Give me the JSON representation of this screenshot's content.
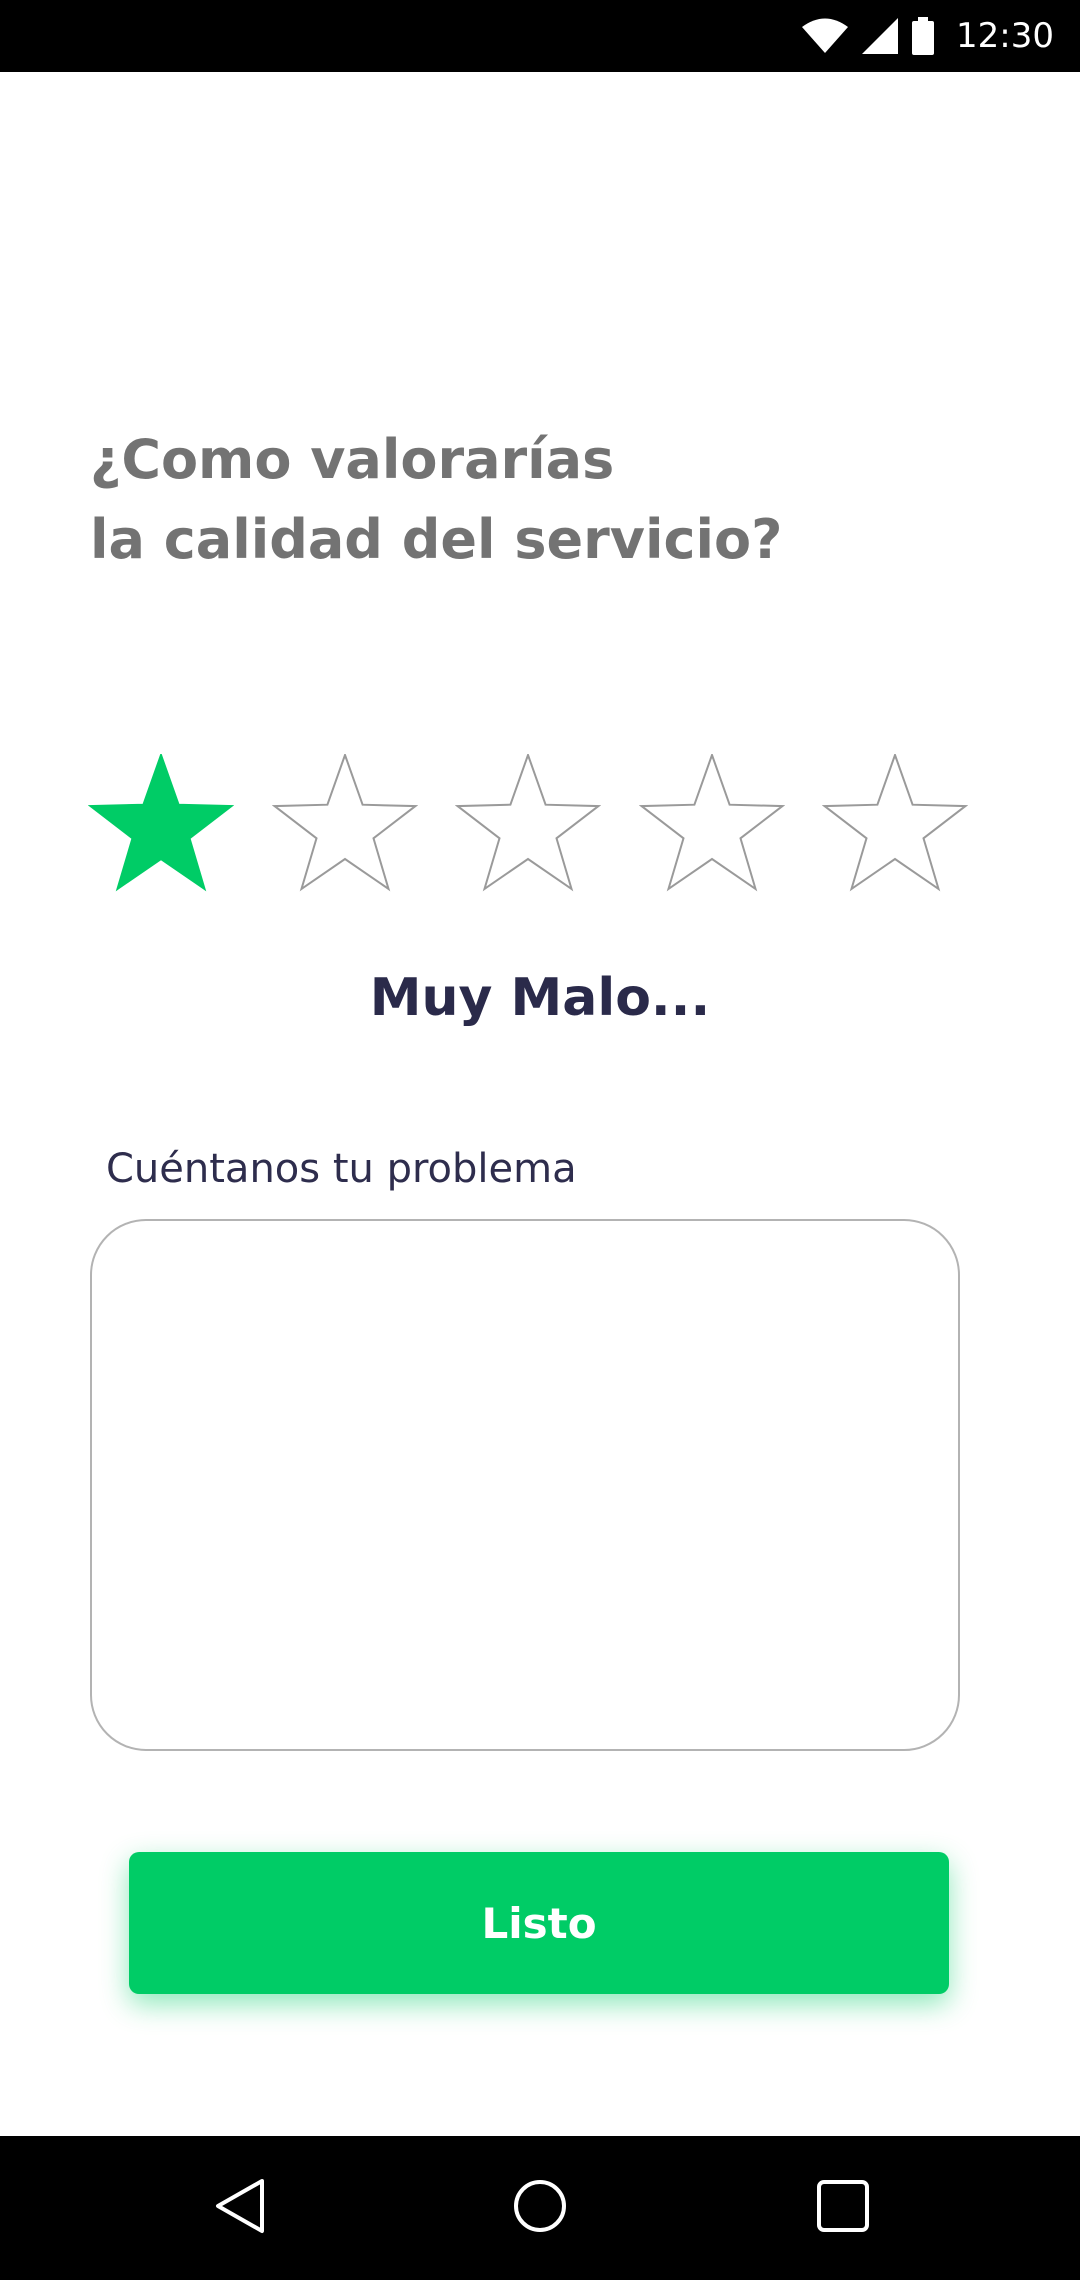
{
  "status_bar": {
    "time": "12:30",
    "icons": [
      "wifi-icon",
      "cellular-signal-icon",
      "battery-icon"
    ]
  },
  "question": {
    "line1": "¿Como valorarías",
    "line2": "la calidad del servicio?"
  },
  "rating": {
    "value": 1,
    "max": 5,
    "label": "Muy Malo...",
    "filled_color": "#00cc66",
    "empty_outline_color": "#9a9a9a"
  },
  "problem_field": {
    "label": "Cuéntanos tu problema",
    "value": "",
    "placeholder": ""
  },
  "done_button": {
    "label": "Listo",
    "color": "#00cc66"
  },
  "nav_bar": {
    "icons": [
      "back-icon",
      "home-icon",
      "recents-icon"
    ]
  }
}
